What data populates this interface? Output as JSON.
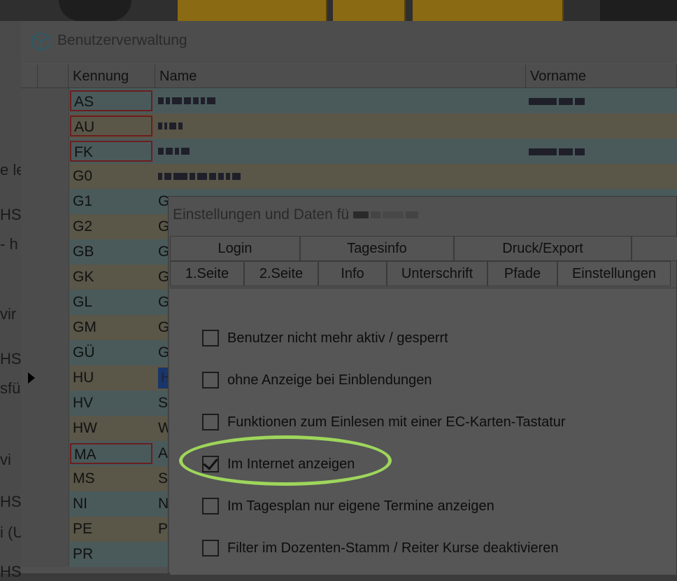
{
  "window": {
    "title": "Benutzerverwaltung",
    "columns": [
      "Kennung",
      "Name",
      "Vorname"
    ],
    "rows": [
      {
        "kennung": "AS",
        "name": "",
        "vorname": "",
        "flag": "red",
        "style": "a"
      },
      {
        "kennung": "AU",
        "name": "",
        "vorname": "",
        "flag": "red",
        "style": "b"
      },
      {
        "kennung": "FK",
        "name": "",
        "vorname": "",
        "flag": "red",
        "style": "a"
      },
      {
        "kennung": "G0",
        "name": "",
        "vorname": "",
        "flag": "",
        "style": "b"
      },
      {
        "kennung": "G1",
        "name": "G",
        "vorname": "",
        "flag": "",
        "style": "a"
      },
      {
        "kennung": "G2",
        "name": "G",
        "vorname": "",
        "flag": "",
        "style": "b"
      },
      {
        "kennung": "GB",
        "name": "G",
        "vorname": "",
        "flag": "",
        "style": "a"
      },
      {
        "kennung": "GK",
        "name": "G",
        "vorname": "",
        "flag": "",
        "style": "b"
      },
      {
        "kennung": "GL",
        "name": "G",
        "vorname": "",
        "flag": "",
        "style": "a"
      },
      {
        "kennung": "GM",
        "name": "G",
        "vorname": "",
        "flag": "",
        "style": "b"
      },
      {
        "kennung": "GÜ",
        "name": "G",
        "vorname": "",
        "flag": "",
        "style": "a"
      },
      {
        "kennung": "HU",
        "name": "H",
        "vorname": "",
        "flag": "",
        "style": "b",
        "current": true
      },
      {
        "kennung": "HV",
        "name": "S",
        "vorname": "",
        "flag": "",
        "style": "a"
      },
      {
        "kennung": "HW",
        "name": "W",
        "vorname": "",
        "flag": "",
        "style": "b"
      },
      {
        "kennung": "MA",
        "name": "A",
        "vorname": "",
        "flag": "red",
        "style": "a"
      },
      {
        "kennung": "MS",
        "name": "S",
        "vorname": "",
        "flag": "",
        "style": "b"
      },
      {
        "kennung": "NI",
        "name": "N",
        "vorname": "",
        "flag": "",
        "style": "a"
      },
      {
        "kennung": "PE",
        "name": "P",
        "vorname": "",
        "flag": "",
        "style": "b"
      },
      {
        "kennung": "PR",
        "name": "",
        "vorname": "",
        "flag": "",
        "style": "a"
      }
    ]
  },
  "left_fragments": [
    "e le",
    "HS",
    "- h",
    "vir",
    "HS",
    "sfü",
    "vi",
    "HS",
    "i (U",
    "HS"
  ],
  "dialog": {
    "title": "Einstellungen und Daten fü",
    "tabs_row1": [
      "Login",
      "Tagesinfo",
      "Druck/Export"
    ],
    "tabs_row2": [
      "1.Seite",
      "2.Seite",
      "Info",
      "Unterschrift",
      "Pfade",
      "Einstellungen"
    ],
    "options": [
      {
        "label": "Benutzer nicht mehr aktiv / gesperrt",
        "checked": false
      },
      {
        "label": "ohne Anzeige bei Einblendungen",
        "checked": false
      },
      {
        "label": "Funktionen zum Einlesen mit einer EC-Karten-Tastatur",
        "checked": false
      },
      {
        "label": "Im Internet anzeigen",
        "checked": true
      },
      {
        "label": "Im Tagesplan nur eigene Termine anzeigen",
        "checked": false
      },
      {
        "label": "Filter im Dozenten-Stamm / Reiter Kurse deaktivieren",
        "checked": false
      }
    ]
  },
  "colors": {
    "highlight": "#9ed65b",
    "selection": "#18366b",
    "error_border": "#6b1e1e"
  }
}
